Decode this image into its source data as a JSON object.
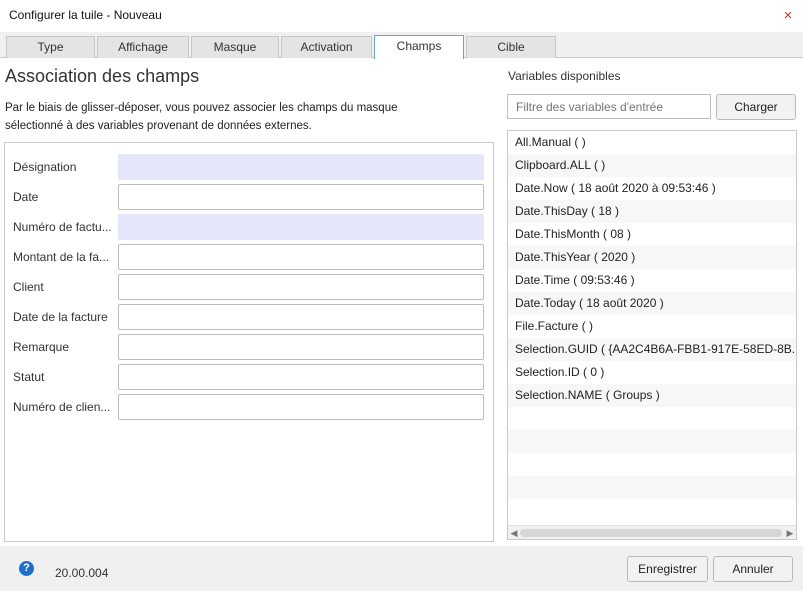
{
  "window": {
    "title": "Configurer la tuile - Nouveau",
    "close_glyph": "×"
  },
  "tabs": [
    {
      "label": "Type"
    },
    {
      "label": "Affichage"
    },
    {
      "label": "Masque"
    },
    {
      "label": "Activation"
    },
    {
      "label": "Champs",
      "active": true
    },
    {
      "label": "Cible"
    }
  ],
  "main": {
    "title": "Association des champs",
    "description": "Par le biais de glisser-déposer, vous pouvez associer les champs du masque sélectionné à des variables provenant de données externes.",
    "fields": [
      {
        "label": "Désignation",
        "value": "",
        "filled": true
      },
      {
        "label": "Date",
        "value": "",
        "filled": false
      },
      {
        "label": "Numéro de factu...",
        "value": "",
        "filled": true
      },
      {
        "label": "Montant de la fa...",
        "value": "",
        "filled": false
      },
      {
        "label": "Client",
        "value": "",
        "filled": false
      },
      {
        "label": "Date de la facture",
        "value": "",
        "filled": false
      },
      {
        "label": "Remarque",
        "value": "",
        "filled": false
      },
      {
        "label": "Statut",
        "value": "",
        "filled": false
      },
      {
        "label": "Numéro de clien...",
        "value": "",
        "filled": false
      }
    ]
  },
  "variables": {
    "title": "Variables disponibles",
    "filter_placeholder": "Filtre des variables d'entrée",
    "load_label": "Charger",
    "items": [
      "All.Manual ( )",
      "Clipboard.ALL ( )",
      "Date.Now ( 18 août 2020 à 09:53:46 )",
      "Date.ThisDay ( 18 )",
      "Date.ThisMonth ( 08 )",
      "Date.ThisYear ( 2020 )",
      "Date.Time ( 09:53:46 )",
      "Date.Today ( 18 août 2020 )",
      "File.Facture ( )",
      "Selection.GUID ( {AA2C4B6A-FBB1-917E-58ED-8B... )",
      "Selection.ID ( 0 )",
      "Selection.NAME ( Groups )"
    ]
  },
  "footer": {
    "help_glyph": "?",
    "version": "20.00.004",
    "save_label": "Enregistrer",
    "cancel_label": "Annuler"
  },
  "colors": {
    "active_tab_border": "#6aa0d8",
    "filled_field": "#e6e6fb",
    "help_icon": "#1f6fc9"
  }
}
